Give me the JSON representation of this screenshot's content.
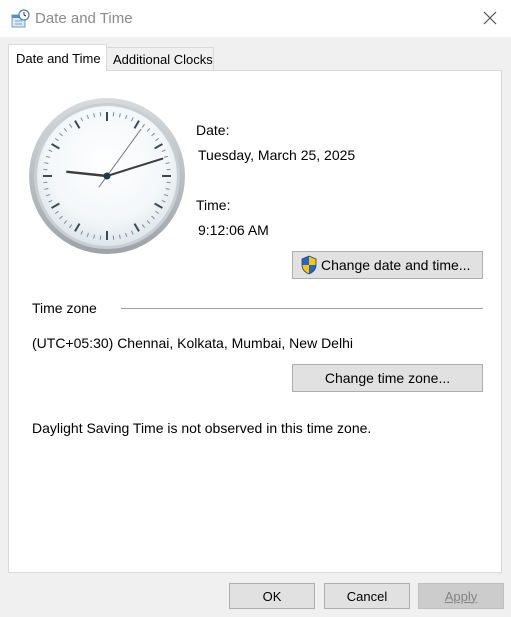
{
  "window": {
    "title": "Date and Time",
    "icon": "date-time-app-icon",
    "close_icon": "close-icon"
  },
  "tabs": [
    {
      "label": "Date and Time",
      "selected": true
    },
    {
      "label": "Additional Clocks",
      "selected": false
    }
  ],
  "clock": {
    "time": "9:12:06"
  },
  "date_section": {
    "date_label": "Date:",
    "date_value": "Tuesday, March 25, 2025",
    "time_label": "Time:",
    "time_value": "9:12:06 AM",
    "change_button": "Change date and time...",
    "change_button_icon": "uac-shield-icon"
  },
  "timezone_section": {
    "heading": "Time zone",
    "value": "(UTC+05:30) Chennai, Kolkata, Mumbai, New Delhi",
    "change_button": "Change time zone...",
    "dst_note": "Daylight Saving Time is not observed in this time zone."
  },
  "footer": {
    "ok": "OK",
    "cancel": "Cancel",
    "apply": "Apply"
  }
}
